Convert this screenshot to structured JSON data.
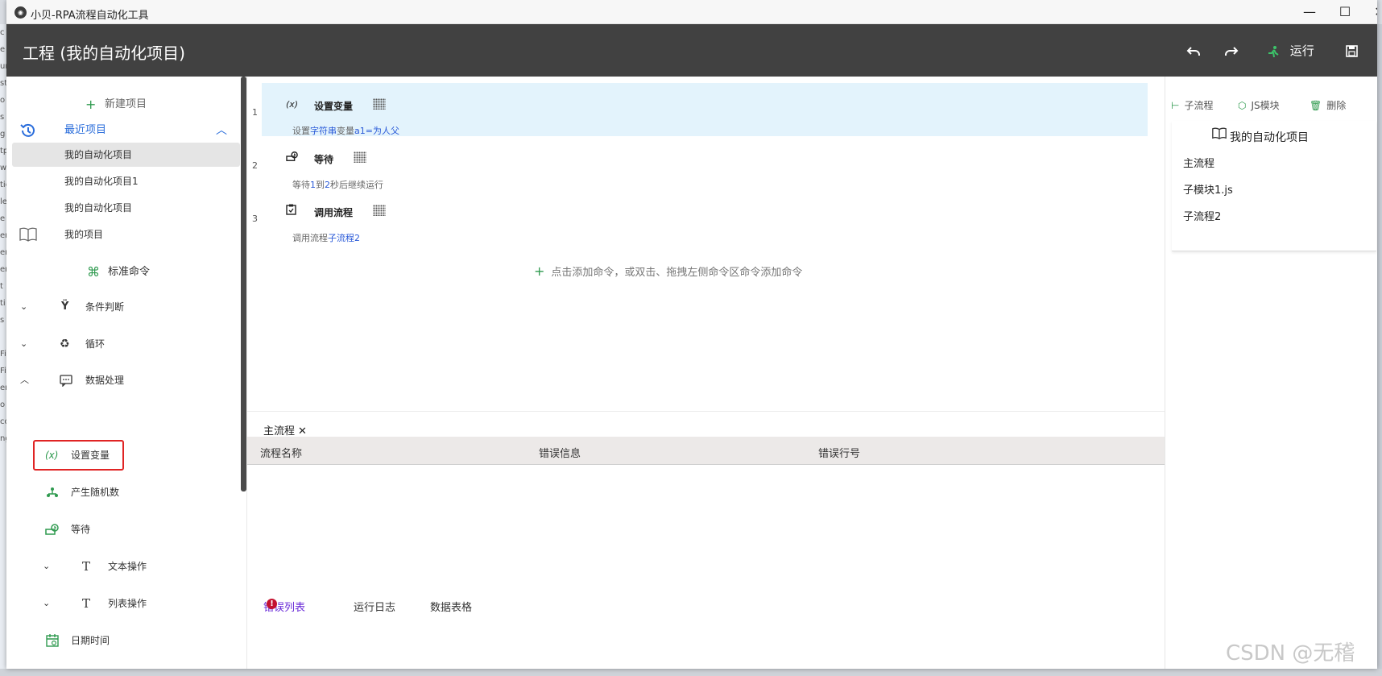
{
  "window": {
    "app_title": "小贝-RPA流程自动化工具",
    "app_icon": "app-logo-icon",
    "controls": {
      "minimize": "—",
      "maximize": "☐",
      "close": "✕"
    }
  },
  "header": {
    "title": "工程 (我的自动化项目)",
    "run_label": "运行",
    "icons": [
      "undo-icon",
      "redo-icon",
      "run-icon",
      "save-icon"
    ],
    "background": "#414141"
  },
  "left_panel": {
    "new_project": "新建项目",
    "recent_projects_label": "最近项目",
    "recent_projects": [
      "我的自动化项目",
      "我的自动化项目1",
      "我的自动化项目"
    ],
    "my_projects": "我的项目",
    "standard_commands": "标准命令",
    "categories": [
      {
        "label": "条件判断",
        "expanded": false
      },
      {
        "label": "循环",
        "expanded": false
      },
      {
        "label": "数据处理",
        "expanded": true
      }
    ],
    "data_commands": [
      "设置变量",
      "产生随机数",
      "等待"
    ],
    "sub_categories": [
      "文本操作",
      "列表操作"
    ],
    "date_time": "日期时间",
    "highlighted_command": "设置变量",
    "accent": "#2f9a4f"
  },
  "editor": {
    "commands": [
      {
        "line": "1",
        "icon": "(x)",
        "title": "设置变量",
        "desc_parts": [
          "设置",
          "字符串",
          "变量",
          "a1=为人父"
        ]
      },
      {
        "line": "2",
        "icon": "wait-icon",
        "title": "等待",
        "desc_parts": [
          "等待",
          "1",
          "到",
          "2",
          "秒后继续运行"
        ]
      },
      {
        "line": "3",
        "icon": "call-flow-icon",
        "title": "调用流程",
        "desc_parts": [
          "调用流程",
          "子流程2"
        ]
      }
    ],
    "add_hint": "点击添加命令，或双击、拖拽左侧命令区命令添加命令"
  },
  "bottom_panel": {
    "open_tab": "主流程",
    "columns": [
      "流程名称",
      "错误信息",
      "错误行号"
    ],
    "tabs": [
      "错误列表",
      "运行日志",
      "数据表格"
    ],
    "error_badge": "!"
  },
  "right_panel": {
    "tools": [
      "子流程",
      "JS模块",
      "删除"
    ],
    "project_name": "我的自动化项目",
    "tree": [
      "主流程",
      "子模块1.js",
      "子流程2"
    ]
  },
  "desktop_left_chars": [
    "c",
    "e",
    "ur",
    "st",
    "o",
    "s",
    "g",
    "tp",
    "w",
    "tic",
    "le",
    "e",
    "er",
    "en",
    "er",
    "t",
    "ti",
    "s",
    "",
    "Fil",
    "Fil",
    "er",
    "o",
    "co",
    "ng"
  ],
  "watermark": "CSDN @无稽"
}
